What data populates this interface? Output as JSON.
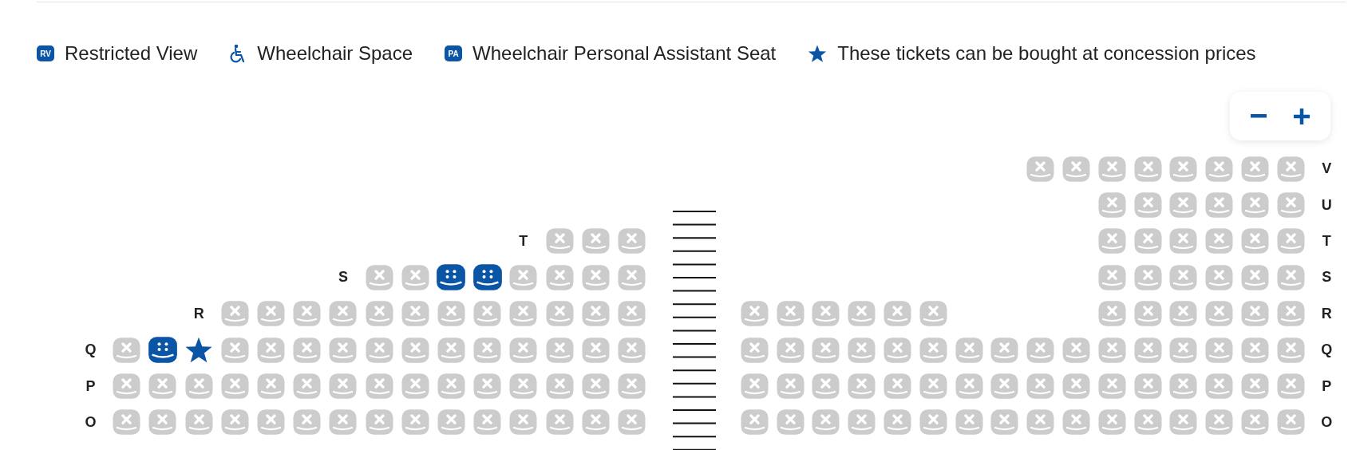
{
  "legend": [
    {
      "kind": "badge",
      "badge": "RV",
      "label": "Restricted View"
    },
    {
      "kind": "wheelchair",
      "label": "Wheelchair Space"
    },
    {
      "kind": "badge",
      "badge": "PA",
      "label": "Wheelchair Personal Assistant Seat"
    },
    {
      "kind": "star",
      "label": "These tickets can be bought at concession prices"
    }
  ],
  "zoom_controls": [
    {
      "kind": "minus"
    },
    {
      "kind": "plus"
    }
  ],
  "left_block": {
    "rows": [
      {
        "label": "T",
        "seats": [
          {
            "kind": "gap"
          },
          {
            "kind": "gap"
          },
          {
            "kind": "gap"
          },
          {
            "kind": "gap"
          },
          {
            "kind": "gap"
          },
          {
            "kind": "gap"
          },
          {
            "kind": "gap"
          },
          {
            "kind": "gap"
          },
          {
            "kind": "gap"
          },
          {
            "kind": "gap"
          },
          {
            "kind": "gap"
          },
          {
            "kind": "gap"
          },
          {
            "kind": "unavailable"
          },
          {
            "kind": "unavailable"
          },
          {
            "kind": "unavailable"
          }
        ]
      },
      {
        "label": "S",
        "seats": [
          {
            "kind": "gap"
          },
          {
            "kind": "gap"
          },
          {
            "kind": "gap"
          },
          {
            "kind": "gap"
          },
          {
            "kind": "gap"
          },
          {
            "kind": "gap"
          },
          {
            "kind": "gap"
          },
          {
            "kind": "unavailable"
          },
          {
            "kind": "unavailable"
          },
          {
            "kind": "available"
          },
          {
            "kind": "available"
          },
          {
            "kind": "unavailable"
          },
          {
            "kind": "unavailable"
          },
          {
            "kind": "unavailable"
          },
          {
            "kind": "unavailable"
          }
        ]
      },
      {
        "label": "R",
        "seats": [
          {
            "kind": "gap"
          },
          {
            "kind": "gap"
          },
          {
            "kind": "gap"
          },
          {
            "kind": "unavailable"
          },
          {
            "kind": "unavailable"
          },
          {
            "kind": "unavailable"
          },
          {
            "kind": "unavailable"
          },
          {
            "kind": "unavailable"
          },
          {
            "kind": "unavailable"
          },
          {
            "kind": "unavailable"
          },
          {
            "kind": "unavailable"
          },
          {
            "kind": "unavailable"
          },
          {
            "kind": "unavailable"
          },
          {
            "kind": "unavailable"
          },
          {
            "kind": "unavailable"
          }
        ]
      },
      {
        "label": "Q",
        "seats": [
          {
            "kind": "unavailable"
          },
          {
            "kind": "available"
          },
          {
            "kind": "concession"
          },
          {
            "kind": "unavailable"
          },
          {
            "kind": "unavailable"
          },
          {
            "kind": "unavailable"
          },
          {
            "kind": "unavailable"
          },
          {
            "kind": "unavailable"
          },
          {
            "kind": "unavailable"
          },
          {
            "kind": "unavailable"
          },
          {
            "kind": "unavailable"
          },
          {
            "kind": "unavailable"
          },
          {
            "kind": "unavailable"
          },
          {
            "kind": "unavailable"
          },
          {
            "kind": "unavailable"
          }
        ]
      },
      {
        "label": "P",
        "seats": [
          {
            "kind": "unavailable"
          },
          {
            "kind": "unavailable"
          },
          {
            "kind": "unavailable"
          },
          {
            "kind": "unavailable"
          },
          {
            "kind": "unavailable"
          },
          {
            "kind": "unavailable"
          },
          {
            "kind": "unavailable"
          },
          {
            "kind": "unavailable"
          },
          {
            "kind": "unavailable"
          },
          {
            "kind": "unavailable"
          },
          {
            "kind": "unavailable"
          },
          {
            "kind": "unavailable"
          },
          {
            "kind": "unavailable"
          },
          {
            "kind": "unavailable"
          },
          {
            "kind": "unavailable"
          }
        ]
      },
      {
        "label": "O",
        "seats": [
          {
            "kind": "unavailable"
          },
          {
            "kind": "unavailable"
          },
          {
            "kind": "unavailable"
          },
          {
            "kind": "unavailable"
          },
          {
            "kind": "unavailable"
          },
          {
            "kind": "unavailable"
          },
          {
            "kind": "unavailable"
          },
          {
            "kind": "unavailable"
          },
          {
            "kind": "unavailable"
          },
          {
            "kind": "unavailable"
          },
          {
            "kind": "unavailable"
          },
          {
            "kind": "unavailable"
          },
          {
            "kind": "unavailable"
          },
          {
            "kind": "unavailable"
          },
          {
            "kind": "unavailable"
          }
        ]
      }
    ]
  },
  "right_block": {
    "rows": [
      {
        "label": "V",
        "seats": [
          {
            "kind": "gap"
          },
          {
            "kind": "gap"
          },
          {
            "kind": "gap"
          },
          {
            "kind": "gap"
          },
          {
            "kind": "gap"
          },
          {
            "kind": "gap"
          },
          {
            "kind": "gap"
          },
          {
            "kind": "gap"
          },
          {
            "kind": "unavailable"
          },
          {
            "kind": "unavailable"
          },
          {
            "kind": "unavailable"
          },
          {
            "kind": "unavailable"
          },
          {
            "kind": "unavailable"
          },
          {
            "kind": "unavailable"
          },
          {
            "kind": "unavailable"
          },
          {
            "kind": "unavailable"
          }
        ]
      },
      {
        "label": "U",
        "seats": [
          {
            "kind": "gap"
          },
          {
            "kind": "gap"
          },
          {
            "kind": "gap"
          },
          {
            "kind": "gap"
          },
          {
            "kind": "gap"
          },
          {
            "kind": "gap"
          },
          {
            "kind": "gap"
          },
          {
            "kind": "gap"
          },
          {
            "kind": "gap"
          },
          {
            "kind": "gap"
          },
          {
            "kind": "unavailable"
          },
          {
            "kind": "unavailable"
          },
          {
            "kind": "unavailable"
          },
          {
            "kind": "unavailable"
          },
          {
            "kind": "unavailable"
          },
          {
            "kind": "unavailable"
          }
        ]
      },
      {
        "label": "T",
        "seats": [
          {
            "kind": "gap"
          },
          {
            "kind": "gap"
          },
          {
            "kind": "gap"
          },
          {
            "kind": "gap"
          },
          {
            "kind": "gap"
          },
          {
            "kind": "gap"
          },
          {
            "kind": "gap"
          },
          {
            "kind": "gap"
          },
          {
            "kind": "gap"
          },
          {
            "kind": "gap"
          },
          {
            "kind": "unavailable"
          },
          {
            "kind": "unavailable"
          },
          {
            "kind": "unavailable"
          },
          {
            "kind": "unavailable"
          },
          {
            "kind": "unavailable"
          },
          {
            "kind": "unavailable"
          }
        ]
      },
      {
        "label": "S",
        "seats": [
          {
            "kind": "gap"
          },
          {
            "kind": "gap"
          },
          {
            "kind": "gap"
          },
          {
            "kind": "gap"
          },
          {
            "kind": "gap"
          },
          {
            "kind": "gap"
          },
          {
            "kind": "gap"
          },
          {
            "kind": "gap"
          },
          {
            "kind": "gap"
          },
          {
            "kind": "gap"
          },
          {
            "kind": "unavailable"
          },
          {
            "kind": "unavailable"
          },
          {
            "kind": "unavailable"
          },
          {
            "kind": "unavailable"
          },
          {
            "kind": "unavailable"
          },
          {
            "kind": "unavailable"
          }
        ]
      },
      {
        "label": "R",
        "seats": [
          {
            "kind": "unavailable"
          },
          {
            "kind": "unavailable"
          },
          {
            "kind": "unavailable"
          },
          {
            "kind": "unavailable"
          },
          {
            "kind": "unavailable"
          },
          {
            "kind": "unavailable"
          },
          {
            "kind": "gap"
          },
          {
            "kind": "gap"
          },
          {
            "kind": "gap"
          },
          {
            "kind": "gap"
          },
          {
            "kind": "unavailable"
          },
          {
            "kind": "unavailable"
          },
          {
            "kind": "unavailable"
          },
          {
            "kind": "unavailable"
          },
          {
            "kind": "unavailable"
          },
          {
            "kind": "unavailable"
          }
        ]
      },
      {
        "label": "Q",
        "seats": [
          {
            "kind": "unavailable"
          },
          {
            "kind": "unavailable"
          },
          {
            "kind": "unavailable"
          },
          {
            "kind": "unavailable"
          },
          {
            "kind": "unavailable"
          },
          {
            "kind": "unavailable"
          },
          {
            "kind": "unavailable"
          },
          {
            "kind": "unavailable"
          },
          {
            "kind": "unavailable"
          },
          {
            "kind": "unavailable"
          },
          {
            "kind": "unavailable"
          },
          {
            "kind": "unavailable"
          },
          {
            "kind": "unavailable"
          },
          {
            "kind": "unavailable"
          },
          {
            "kind": "unavailable"
          },
          {
            "kind": "unavailable"
          }
        ]
      },
      {
        "label": "P",
        "seats": [
          {
            "kind": "unavailable"
          },
          {
            "kind": "unavailable"
          },
          {
            "kind": "unavailable"
          },
          {
            "kind": "unavailable"
          },
          {
            "kind": "unavailable"
          },
          {
            "kind": "unavailable"
          },
          {
            "kind": "unavailable"
          },
          {
            "kind": "unavailable"
          },
          {
            "kind": "unavailable"
          },
          {
            "kind": "unavailable"
          },
          {
            "kind": "unavailable"
          },
          {
            "kind": "unavailable"
          },
          {
            "kind": "unavailable"
          },
          {
            "kind": "unavailable"
          },
          {
            "kind": "unavailable"
          },
          {
            "kind": "unavailable"
          }
        ]
      },
      {
        "label": "O",
        "seats": [
          {
            "kind": "unavailable"
          },
          {
            "kind": "unavailable"
          },
          {
            "kind": "unavailable"
          },
          {
            "kind": "unavailable"
          },
          {
            "kind": "unavailable"
          },
          {
            "kind": "unavailable"
          },
          {
            "kind": "unavailable"
          },
          {
            "kind": "unavailable"
          },
          {
            "kind": "unavailable"
          },
          {
            "kind": "unavailable"
          },
          {
            "kind": "unavailable"
          },
          {
            "kind": "unavailable"
          },
          {
            "kind": "unavailable"
          },
          {
            "kind": "unavailable"
          },
          {
            "kind": "unavailable"
          },
          {
            "kind": "unavailable"
          }
        ]
      }
    ]
  }
}
